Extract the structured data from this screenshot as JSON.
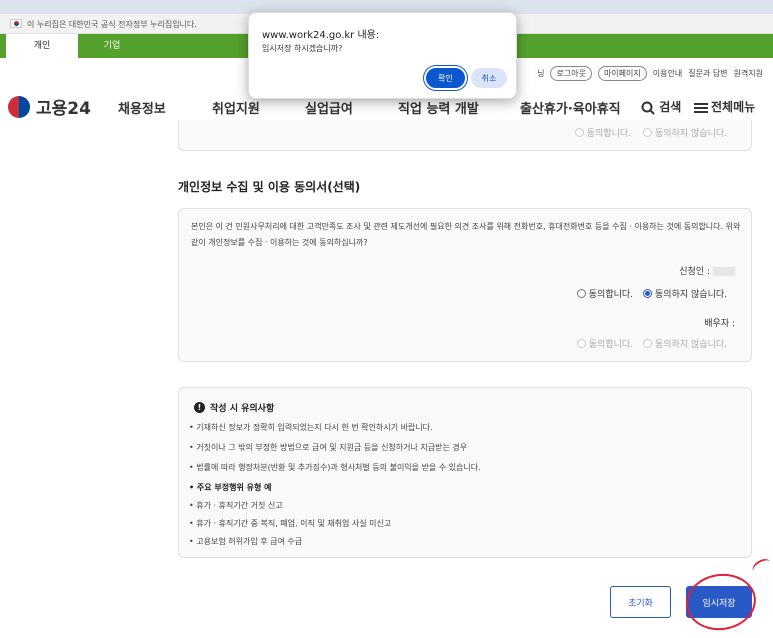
{
  "gov_bar": {
    "text": "이 누리집은 대한민국 공식 전자정부 누리집입니다."
  },
  "user_tabs": {
    "personal": "개인",
    "business": "기업"
  },
  "util_links": {
    "prefix": "닝",
    "logout": "로그아웃",
    "mypage": "마이페이지",
    "guide": "이용안내",
    "faq": "질문과 답변",
    "remote": "원격지원"
  },
  "gnb": {
    "logo_text": "고용24",
    "items": [
      "채용정보",
      "취업지원",
      "실업급여",
      "직업 능력 개발",
      "출산휴가·육아휴직"
    ],
    "search": "검색",
    "all_menu": "전체메뉴"
  },
  "prev_section": {
    "agree": "동의합니다.",
    "disagree": "동의하지 않습니다."
  },
  "consent": {
    "title": "개인정보 수집 및 이용 동의서(선택)",
    "body": "본인은 이 건 민원사무처리에 대한 고객만족도 조사 및 관련 제도개선에 필요한 의견 조사를 위해 전화번호, 휴대전화번호 등을 수집 · 이용하는 것에 동의합니다. 위와 같이 개인정보를 수집 · 이용하는 것에 동의하십니까?",
    "applicant_label": "신청인 :",
    "spouse_label": "배우자 :",
    "agree": "동의합니다.",
    "disagree": "동의하지 않습니다."
  },
  "notice": {
    "title": "작성 시 유의사항",
    "lines": [
      "• 기재하신 정보가 정확히 입력되었는지 다시 한 번 확인하시기 바랍니다.",
      "• 거짓이나 그 밖의 부정한 방법으로 급여 및 지원금 등을 신청하거나 지급받는 경우",
      "• 법률에 따라 행정처분(반환 및 추가징수)과 형사처벌 등의 불이익을 받을 수 있습니다."
    ],
    "sub_title": "• 주요 부정행위 유형 예",
    "sub_lines": [
      "• 휴가 · 휴직기간 거짓 신고",
      "• 휴가 · 휴직기간 중 복직, 폐업, 이직 및 재취업 사실 미신고",
      "• 고용보험 허위가입 후 급여 수급"
    ]
  },
  "buttons": {
    "reset": "초기화",
    "temp_save": "임시저장"
  },
  "dialog": {
    "title": "www.work24.go.kr 내용:",
    "message": "임시저장 하시겠습니까?",
    "ok": "확인",
    "cancel": "취소"
  },
  "colors": {
    "brand_green": "#55a12e",
    "primary_blue": "#2958c7",
    "annotation_red": "#e0213a"
  }
}
